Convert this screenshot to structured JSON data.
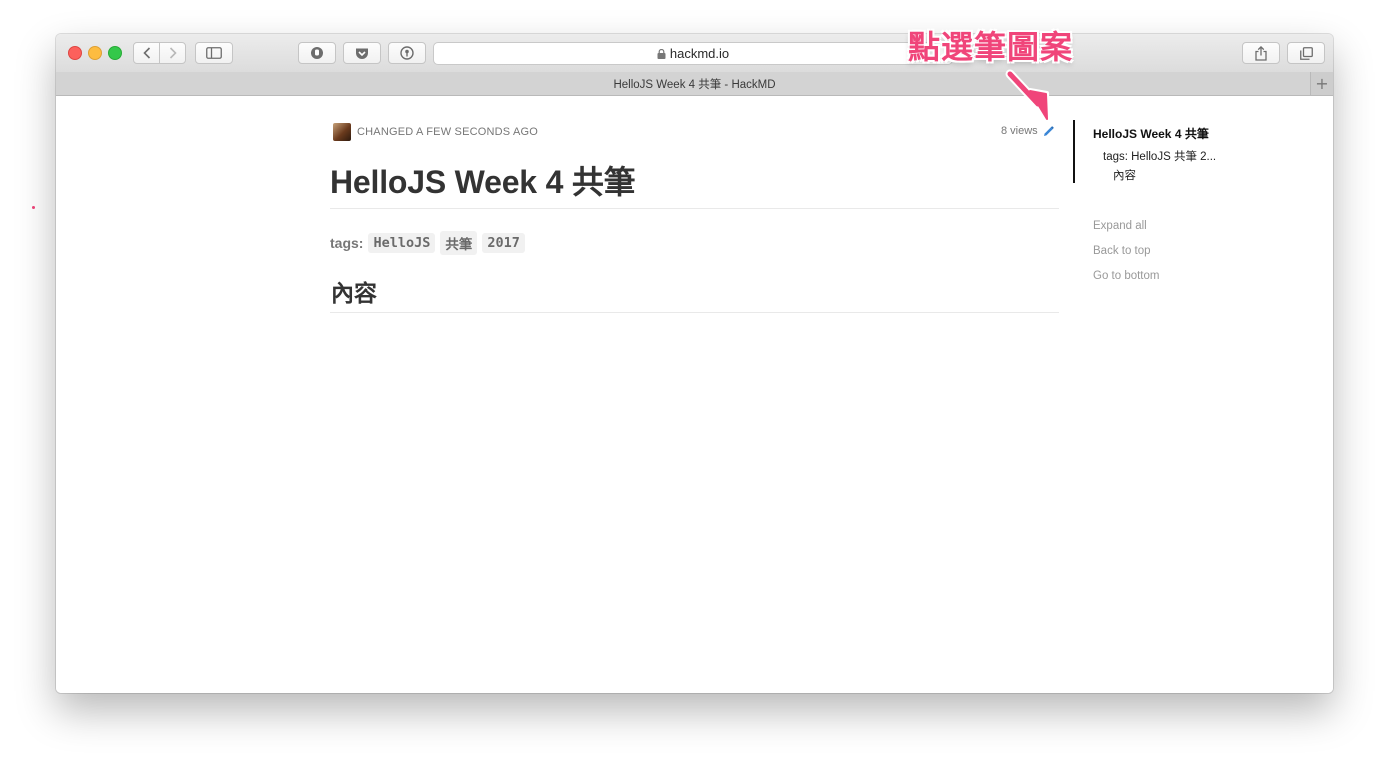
{
  "browser": {
    "address": "hackmd.io",
    "tab_title": "HelloJS Week 4 共筆 - HackMD",
    "new_tab_symbol": "+"
  },
  "doc": {
    "changed_text": "CHANGED A FEW SECONDS AGO",
    "views": "8 views",
    "title": "HelloJS Week 4 共筆",
    "tags_label": "tags:",
    "tags": [
      "HelloJS",
      "共筆",
      "2017"
    ],
    "section_heading": "內容"
  },
  "toc": {
    "items": [
      "HelloJS Week 4 共筆",
      "tags: HelloJS 共筆 2...",
      "內容"
    ]
  },
  "sidebar_links": [
    "Expand all",
    "Back to top",
    "Go to bottom"
  ],
  "annotation": {
    "text": "點選筆圖案",
    "color": "#f0457a"
  },
  "icons": [
    "back-icon",
    "forward-icon",
    "sidebar-icon",
    "privacy-icon",
    "pocket-icon",
    "password-icon",
    "lock-icon",
    "share-icon",
    "tabs-icon",
    "pencil-icon"
  ]
}
